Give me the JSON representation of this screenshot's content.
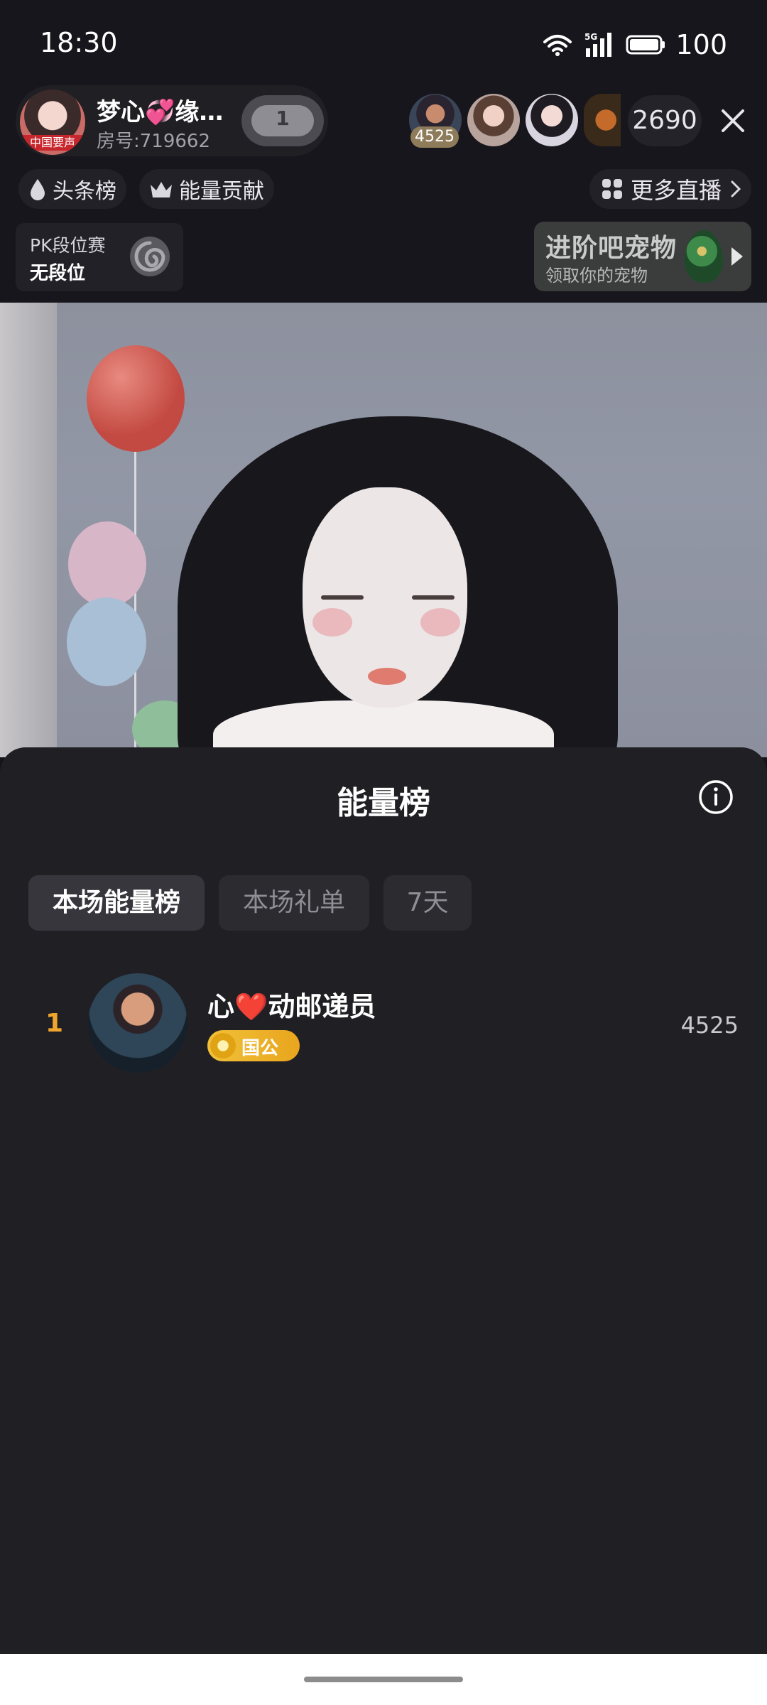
{
  "status_bar": {
    "time": "18:30",
    "network": "5G",
    "battery": "100",
    "icons": [
      "wifi-icon",
      "signal-icon",
      "battery-icon"
    ]
  },
  "live_header": {
    "host_name": "梦心💞缘…",
    "host_avatar_tag": "中国要声",
    "room_number": "房号:719662",
    "follow_level": "1",
    "top_viewer_score": "4525",
    "viewer_count": "2690",
    "chips": {
      "headline_board": "头条榜",
      "energy_contribution": "能量贡献"
    },
    "more_live": "更多直播",
    "pk": {
      "title": "PK段位赛",
      "rank": "无段位"
    },
    "pet_banner": {
      "title": "进阶吧宠物",
      "subtitle": "领取你的宠物"
    }
  },
  "energy_sheet": {
    "title": "能量榜",
    "tabs": [
      {
        "label": "本场能量榜",
        "selected": true
      },
      {
        "label": "本场礼单",
        "selected": false
      },
      {
        "label": "7天",
        "selected": false
      }
    ],
    "ranking": [
      {
        "rank": "1",
        "name": "心❤️动邮递员",
        "badge": "国公",
        "score": "4525"
      }
    ]
  },
  "colors": {
    "background": "#15141a",
    "sheet": "#202024",
    "rank_accent": "#f0a62e",
    "badge_gold": "#f1c13a"
  }
}
